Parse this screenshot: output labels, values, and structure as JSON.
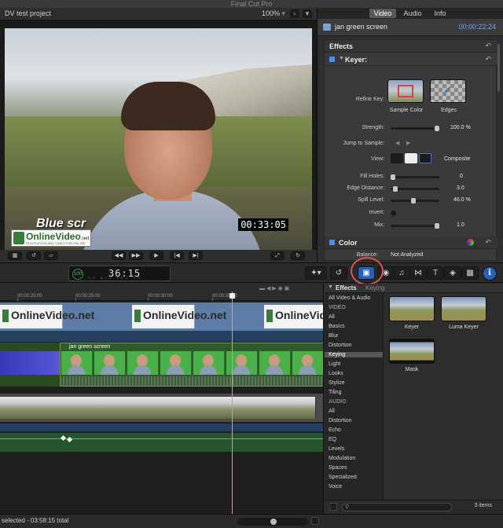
{
  "app": {
    "title": "Final Cut Pro"
  },
  "viewer": {
    "project_name": "DV test project",
    "zoom": "100%",
    "overlay_text": "Blue scr",
    "logo_word": "OnlineVideo",
    "logo_suffix": ".net",
    "logo_tagline": "PLAYSTATION AND VIDEO FOR ONLINE VIDEO",
    "timecode_overlay": "00:33:05"
  },
  "inspector": {
    "tabs": [
      "Video",
      "Audio",
      "Info"
    ],
    "active_tab": "Video",
    "clip_name": "jan green screen",
    "clip_time": "00:00:22:24",
    "effects_header": "Effects",
    "keyer": {
      "name": "Keyer:",
      "refine_key_label": "Refine Key:",
      "sample_color_label": "Sample Color",
      "edges_label": "Edges",
      "strength_label": "Strength:",
      "strength_value": "100.0",
      "strength_unit": "%",
      "strength_level": 1.0,
      "jump_label": "Jump to Sample:",
      "view_label": "View:",
      "view_value": "Composite",
      "fill_holes_label": "Fill Holes:",
      "fill_holes_value": "0",
      "fill_holes_level": 0.0,
      "edge_distance_label": "Edge Distance:",
      "edge_distance_value": "3.0",
      "edge_distance_level": 0.05,
      "spill_level_label": "Spill Level:",
      "spill_level_value": "46.0",
      "spill_level_unit": "%",
      "spill_level_level": 0.46,
      "invert_label": "Invert:",
      "mix_label": "Mix:",
      "mix_value": "1.0",
      "mix_level": 1.0
    },
    "color": {
      "label": "Color",
      "balance_label": "Balance:",
      "balance_value": "Not Analyzed"
    }
  },
  "toolbar": {
    "timecode": "36:15",
    "timecode_percent": "100",
    "timecode_units": "HR MIN SEC FR"
  },
  "timeline": {
    "ruler": [
      "00:00:20:00",
      "00:00:25:00",
      "00:00:30:00",
      "00:00:35:00"
    ],
    "title_clip_word": "OnlineVideo.net",
    "chroma_clip_label": "jan green screen",
    "status": "selected - 03:58:15 total"
  },
  "browser": {
    "title": "Effects",
    "subtitle": "Keying",
    "side": [
      {
        "label": "All Video & Audio",
        "type": "item"
      },
      {
        "label": "VIDEO",
        "type": "header"
      },
      {
        "label": "All",
        "type": "item"
      },
      {
        "label": "Basics",
        "type": "item"
      },
      {
        "label": "Blur",
        "type": "item"
      },
      {
        "label": "Distortion",
        "type": "item"
      },
      {
        "label": "Keying",
        "type": "selected"
      },
      {
        "label": "Light",
        "type": "item"
      },
      {
        "label": "Looks",
        "type": "item"
      },
      {
        "label": "Stylize",
        "type": "item"
      },
      {
        "label": "Tiling",
        "type": "item"
      },
      {
        "label": "AUDIO",
        "type": "header"
      },
      {
        "label": "All",
        "type": "item"
      },
      {
        "label": "Distortion",
        "type": "item"
      },
      {
        "label": "Echo",
        "type": "item"
      },
      {
        "label": "EQ",
        "type": "item"
      },
      {
        "label": "Levels",
        "type": "item"
      },
      {
        "label": "Modulation",
        "type": "item"
      },
      {
        "label": "Spaces",
        "type": "item"
      },
      {
        "label": "Specialized",
        "type": "item"
      },
      {
        "label": "Voice",
        "type": "item"
      }
    ],
    "effects": [
      "Keyer",
      "Luma Keyer",
      "Mask"
    ],
    "item_count": "3 items"
  },
  "colors": {
    "accent": "#2a5fb8",
    "highlight_ring": "#e05550",
    "playhead": "#f08e8e"
  }
}
